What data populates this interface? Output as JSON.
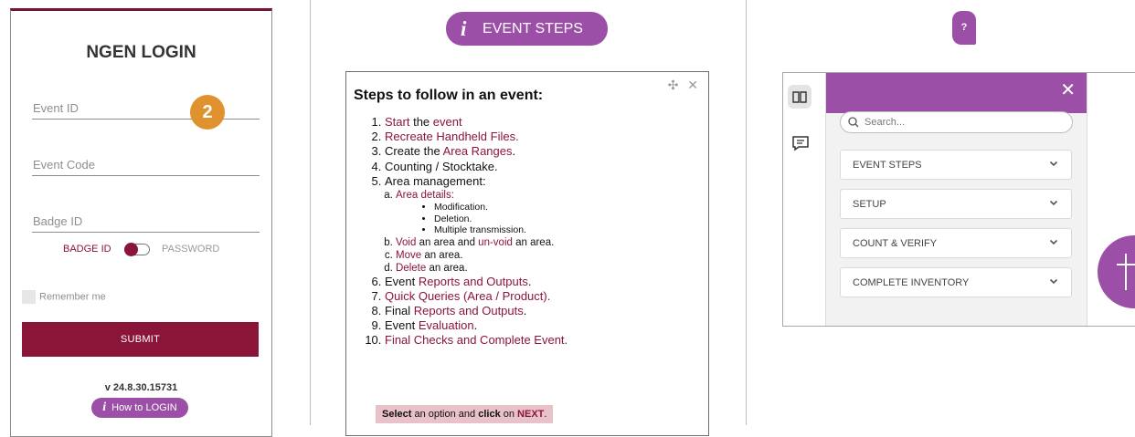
{
  "login": {
    "title": "NGEN LOGIN",
    "event_id_placeholder": "Event ID",
    "event_code_placeholder": "Event Code",
    "badge_id_placeholder": "Badge ID",
    "step_badge": "2",
    "toggle_left": "BADGE ID",
    "toggle_right": "PASSWORD",
    "remember_label": "Remember me",
    "submit_label": "SUBMIT",
    "version": "v 24.8.30.15731",
    "howto_icon": "i",
    "howto_label": "How to LOGIN",
    "accent_color": "#8a1538"
  },
  "steps_pill": {
    "icon": "i",
    "label": "EVENT STEPS"
  },
  "steps": {
    "controls": "✣ ✕",
    "heading": "Steps to follow in an event:",
    "items": [
      {
        "pre": "",
        "link": "Start",
        "post": " the ",
        "link2": "event",
        "post2": ""
      },
      {
        "pre": "",
        "link": "Recreate Handheld Files.",
        "post": "",
        "link2": "",
        "post2": ""
      },
      {
        "pre": "Create the ",
        "link": "Area Ranges",
        "post": ".",
        "link2": "",
        "post2": ""
      },
      {
        "pre": "Counting / Stocktake.",
        "link": "",
        "post": "",
        "link2": "",
        "post2": ""
      },
      {
        "pre": "Area management:",
        "link": "",
        "post": "",
        "link2": "",
        "post2": ""
      },
      {
        "pre": "Event ",
        "link": "Reports and Outputs",
        "post": ".",
        "link2": "",
        "post2": ""
      },
      {
        "pre": "",
        "link": "Quick Queries (Area / Product).",
        "post": "",
        "link2": "",
        "post2": ""
      },
      {
        "pre": "Final ",
        "link": "Reports and Outputs",
        "post": ".",
        "link2": "",
        "post2": ""
      },
      {
        "pre": "Event ",
        "link": "Evaluation",
        "post": ".",
        "link2": "",
        "post2": ""
      },
      {
        "pre": "",
        "link": "Final Checks and Complete Event.",
        "post": "",
        "link2": "",
        "post2": ""
      }
    ],
    "sub": {
      "a_link": "Area details:",
      "a_bullets": [
        "Modification.",
        "Deletion.",
        "Multiple transmission."
      ],
      "b_link1": "Void",
      "b_mid": " an area and ",
      "b_link2": "un-void",
      "b_post": " an area.",
      "c_link": "Move",
      "c_post": " an area.",
      "d_link": "Delete",
      "d_post": " an area."
    },
    "note": {
      "b1": "Select",
      "t1": " an option and ",
      "b2": "click",
      "t2": " on ",
      "b3": "NEXT",
      "t3": "."
    }
  },
  "help_badge": "?",
  "menu": {
    "search_placeholder": "Search...",
    "sections": [
      "EVENT STEPS",
      "SETUP",
      "COUNT & VERIFY",
      "COMPLETE INVENTORY"
    ],
    "primary_color": "#9b4fa6"
  }
}
